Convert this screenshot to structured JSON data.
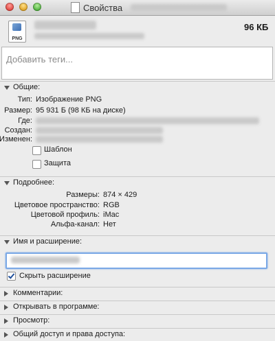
{
  "window": {
    "title": "Свойства"
  },
  "header": {
    "file_icon_label": "PNG",
    "size": "96 КБ"
  },
  "tags": {
    "placeholder": "Добавить теги..."
  },
  "general": {
    "title": "Общие:",
    "type_label": "Тип:",
    "type_value": "Изображение PNG",
    "size_label": "Размер:",
    "size_value": "95 931 Б (98 КБ на диске)",
    "where_label": "Где:",
    "created_label": "Создан:",
    "modified_label": "Изменен:",
    "template_label": "Шаблон",
    "locked_label": "Защита"
  },
  "more_info": {
    "title": "Подробнее:",
    "dimensions_label": "Размеры:",
    "dimensions_value": "874 × 429",
    "color_space_label": "Цветовое пространство:",
    "color_space_value": "RGB",
    "color_profile_label": "Цветовой профиль:",
    "color_profile_value": "iMac",
    "alpha_label": "Альфа-канал:",
    "alpha_value": "Нет"
  },
  "name_ext": {
    "title": "Имя и расширение:",
    "hide_extension_label": "Скрыть расширение",
    "hide_extension_checked": true
  },
  "collapsed_sections": [
    "Комментарии:",
    "Открывать в программе:",
    "Просмотр:",
    "Общий доступ и права доступа:"
  ]
}
